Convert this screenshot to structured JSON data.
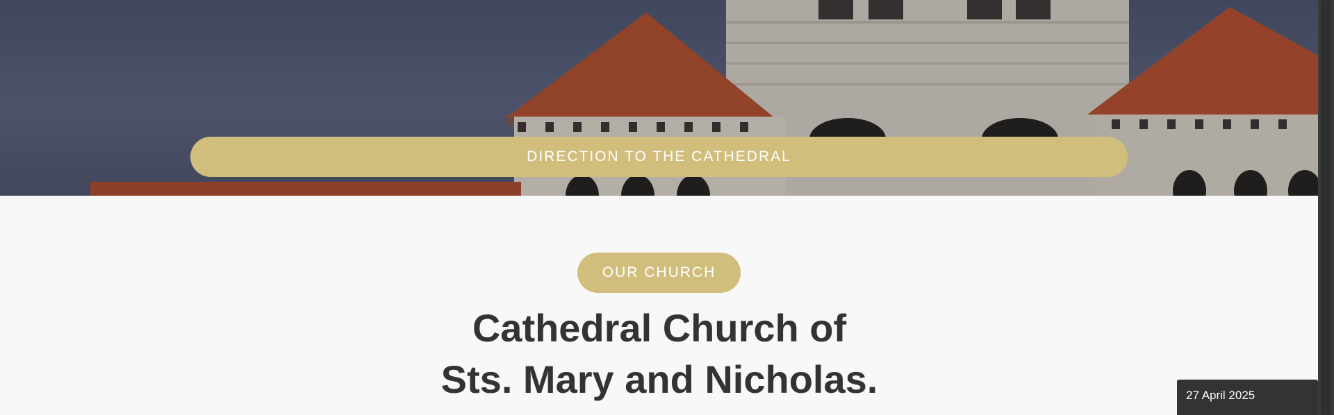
{
  "hero": {
    "direction_label": "DIRECTION TO THE CATHEDRAL"
  },
  "section": {
    "badge_label": "OUR CHURCH",
    "title_line1": "Cathedral Church of",
    "title_line2": "Sts. Mary and Nicholas."
  },
  "footer_widget": {
    "date": "27 April 2025"
  },
  "colors": {
    "accent": "#d1be7d",
    "title_text": "#333333",
    "background": "#f8f8f8",
    "date_box": "#333333"
  }
}
